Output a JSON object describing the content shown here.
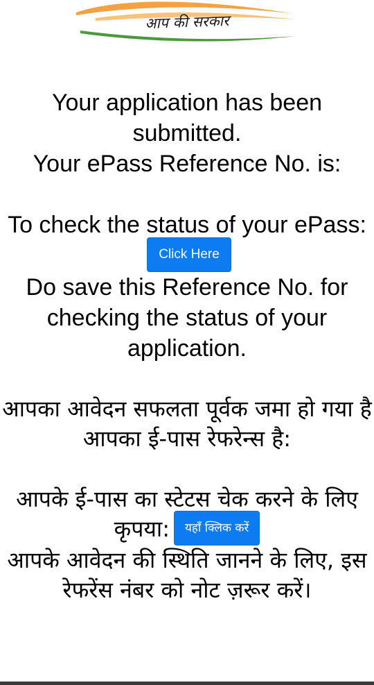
{
  "logo": {
    "text": "आप की सरकार",
    "colors": {
      "saffron": "#f4a142",
      "green": "#4a9a3c"
    }
  },
  "english": {
    "line1": "Your application has been submitted.",
    "line2": "Your ePass Reference No. is:",
    "status_prefix": "To check the status of your ePass:",
    "button_label": "Click Here",
    "save_note": "Do save this Reference No. for checking the status of your application."
  },
  "hindi": {
    "line1": "आपका आवेदन सफलता पूर्वक जमा हो गया है",
    "line2": "आपका ई-पास रेफरेन्स है:",
    "status_prefix": "आपके ई-पास का स्टेटस चेक करने के लिए कृपया:",
    "button_label": "यहाँ क्लिक करें",
    "save_note": "आपके आवेदन की स्थिति जानने के लिए, इस रेफरेंस नंबर को नोट ज़रूर करें।"
  },
  "colors": {
    "button": "#0d7bf2",
    "button_text": "#ffffff"
  }
}
